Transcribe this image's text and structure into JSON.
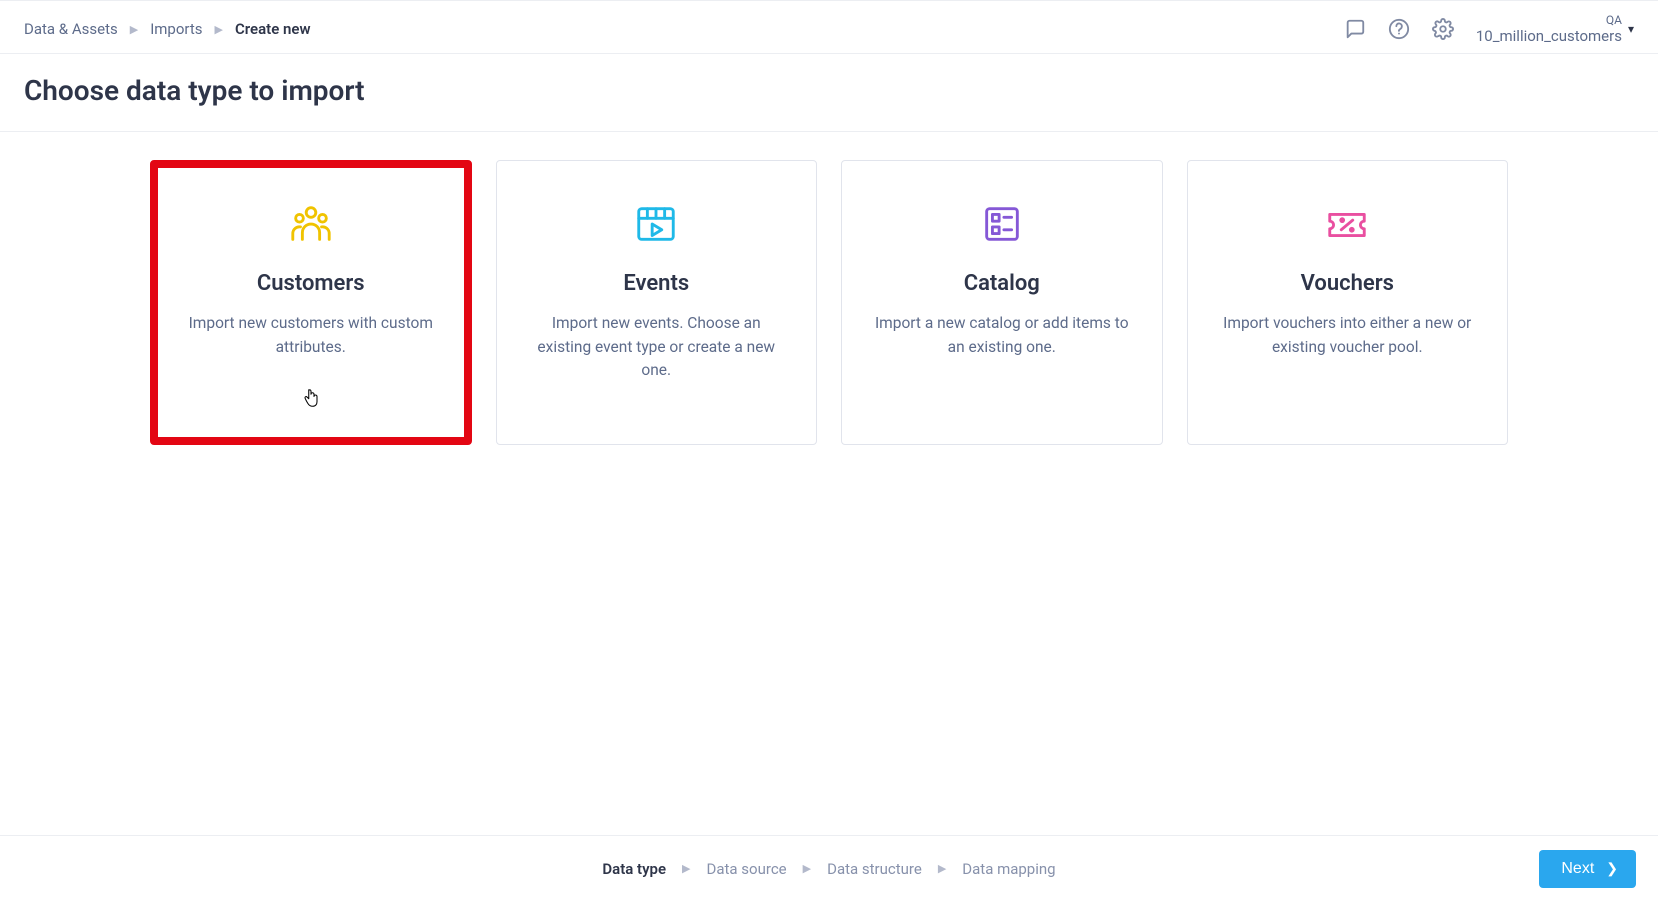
{
  "breadcrumb": {
    "root": "Data & Assets",
    "mid": "Imports",
    "current": "Create new"
  },
  "project": {
    "env": "QA",
    "name": "10_million_customers"
  },
  "page": {
    "title": "Choose data type to import"
  },
  "cards": [
    {
      "title": "Customers",
      "desc": "Import new customers with custom attributes.",
      "selected": true
    },
    {
      "title": "Events",
      "desc": "Import new events. Choose an existing event type or create a new one.",
      "selected": false
    },
    {
      "title": "Catalog",
      "desc": "Import a new catalog or add items to an existing one.",
      "selected": false
    },
    {
      "title": "Vouchers",
      "desc": "Import vouchers into either a new or existing voucher pool.",
      "selected": false
    }
  ],
  "steps": {
    "items": [
      "Data type",
      "Data source",
      "Data structure",
      "Data mapping"
    ],
    "active_index": 0
  },
  "actions": {
    "next": "Next"
  }
}
